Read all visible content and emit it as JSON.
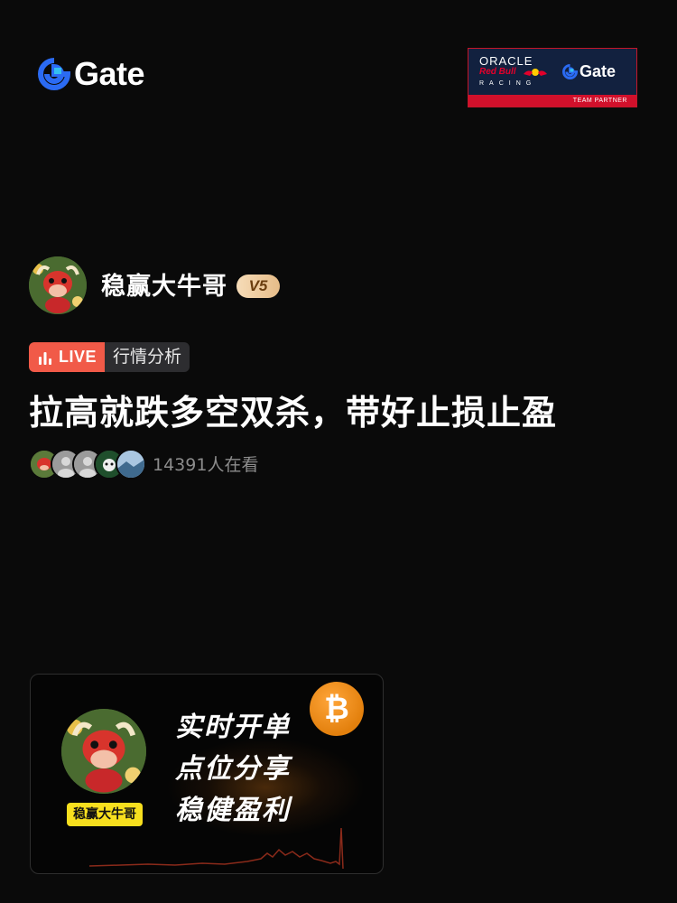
{
  "header": {
    "logo_text": "Gate",
    "partner": {
      "oracle": "ORACLE",
      "redbull": "Red Bull",
      "racing": "RACING",
      "gate_text": "Gate",
      "team_partner": "TEAM PARTNER"
    }
  },
  "host": {
    "name": "稳赢大牛哥",
    "level_badge": "V5"
  },
  "live": {
    "live_label": "LIVE",
    "category": "行情分析",
    "title": "拉高就跌多空双杀，带好止损止盈",
    "viewer_count": "14391人在看"
  },
  "cover": {
    "host_name": "稳赢大牛哥",
    "slogan_lines": [
      "实时开单",
      "点位分享",
      "稳健盈利"
    ],
    "coin_symbol": "₿"
  },
  "colors": {
    "background": "#0a0a0a",
    "live_red": "#f15a48",
    "gate_blue": "#2b6bf3",
    "badge_gold": "#e6bc88",
    "btc_orange": "#f7931a",
    "name_tag_yellow": "#f7df1e"
  },
  "icons": [
    "gate-logo-icon",
    "live-bars-icon",
    "bitcoin-icon",
    "user-avatar-icon"
  ]
}
